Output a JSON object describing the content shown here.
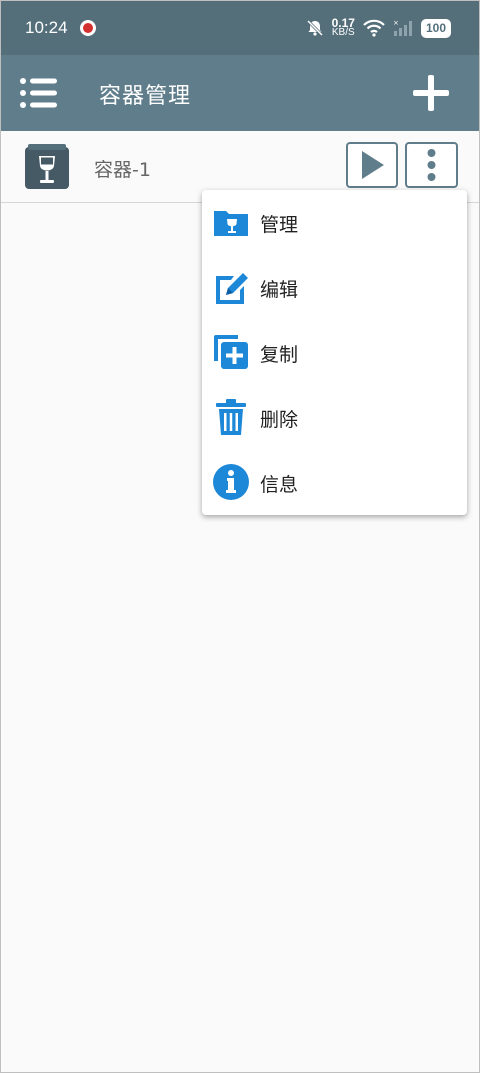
{
  "status_bar": {
    "time": "10:24",
    "net_speed_value": "0.17",
    "net_speed_unit": "KB/S",
    "battery": "100"
  },
  "app_bar": {
    "title": "容器管理",
    "menu_icon": "list-menu-icon",
    "add_icon": "plus-icon"
  },
  "containers": [
    {
      "name": "容器-1",
      "icon": "wine-glass-icon"
    }
  ],
  "context_menu": {
    "items": [
      {
        "label": "管理",
        "icon": "folder-wine-icon"
      },
      {
        "label": "编辑",
        "icon": "edit-icon"
      },
      {
        "label": "复制",
        "icon": "copy-plus-icon"
      },
      {
        "label": "删除",
        "icon": "trash-icon"
      },
      {
        "label": "信息",
        "icon": "info-icon"
      }
    ]
  },
  "colors": {
    "status_bar": "#546e7a",
    "app_bar": "#607d8b",
    "menu_icon_blue": "#1e88d8",
    "background": "#fafafa"
  }
}
